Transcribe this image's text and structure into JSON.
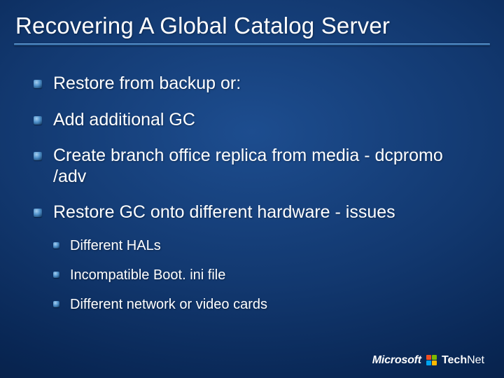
{
  "title": "Recovering A Global Catalog Server",
  "bullets": [
    {
      "text": "Restore from backup or:"
    },
    {
      "text": "Add additional GC"
    },
    {
      "text": "Create branch office replica from media - dcpromo /adv"
    },
    {
      "text": "Restore GC onto different hardware - issues",
      "sub": [
        {
          "text": "Different HALs"
        },
        {
          "text": "Incompatible Boot. ini file"
        },
        {
          "text": "Different network or video cards"
        }
      ]
    }
  ],
  "footer": {
    "brand_left": "Microsoft",
    "brand_right_bold": "Tech",
    "brand_right_rest": "Net"
  }
}
